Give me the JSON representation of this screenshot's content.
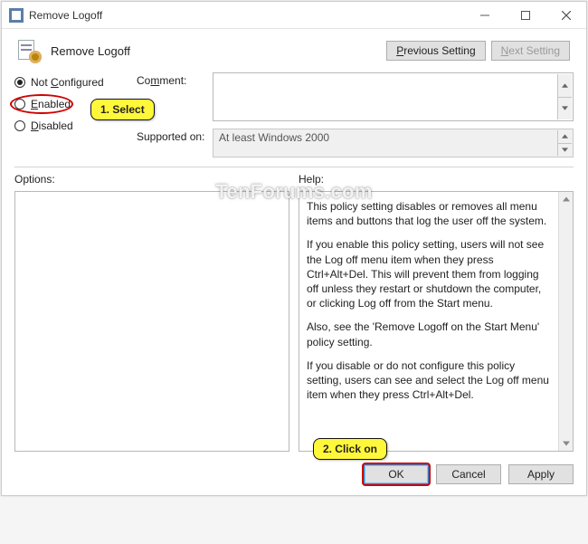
{
  "window": {
    "title": "Remove Logoff"
  },
  "header": {
    "policy_title": "Remove Logoff",
    "prev_label": "Previous Setting",
    "next_label": "Next Setting"
  },
  "radios": {
    "not_configured": "Not Configured",
    "enabled": "Enabled",
    "disabled": "Disabled",
    "selected": "not_configured"
  },
  "fields": {
    "comment_label": "Comment:",
    "supported_label": "Supported on:",
    "supported_value": "At least Windows 2000"
  },
  "panes": {
    "options_label": "Options:",
    "help_label": "Help:",
    "help_paragraphs": [
      "This policy setting disables or removes all menu items and buttons that log the user off the system.",
      "If you enable this policy setting, users will not see the Log off menu item when they press Ctrl+Alt+Del. This will prevent them from logging off unless they restart or shutdown the computer, or clicking Log off from the Start menu.",
      "Also, see the 'Remove Logoff on the Start Menu' policy setting.",
      "If you disable or do not configure this policy setting, users can see and select the Log off menu item when they press Ctrl+Alt+Del."
    ]
  },
  "buttons": {
    "ok": "OK",
    "cancel": "Cancel",
    "apply": "Apply"
  },
  "callouts": {
    "select": "1. Select",
    "click_on": "2. Click on"
  },
  "watermark": "TenForums.com"
}
